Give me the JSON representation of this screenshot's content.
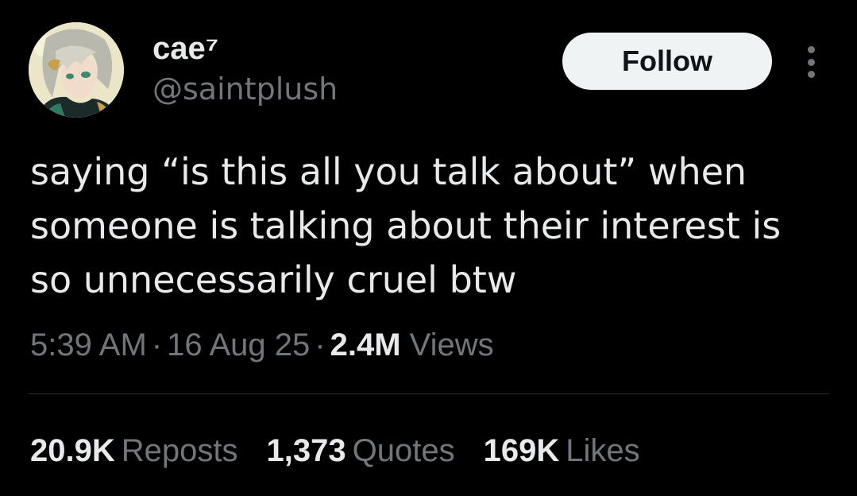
{
  "user": {
    "display_name": "cae⁷",
    "handle": "@saintplush",
    "avatar_icon": "anime-character-avatar"
  },
  "actions": {
    "follow_label": "Follow",
    "more_icon": "more-vertical-icon"
  },
  "tweet": {
    "lines": [
      "saying “is this all you talk about” when",
      "someone is talking about their interest is",
      "so unnecessarily cruel btw"
    ]
  },
  "meta": {
    "time": "5:39 AM",
    "date": "16 Aug 25",
    "views_count": "2.4M",
    "views_label": "Views"
  },
  "stats": [
    {
      "count": "20.9K",
      "label": "Reposts"
    },
    {
      "count": "1,373",
      "label": "Quotes"
    },
    {
      "count": "169K",
      "label": "Likes"
    }
  ],
  "colors": {
    "background": "#000000",
    "primary_text": "#e7e9ea",
    "secondary_text": "#71767b",
    "follow_button_bg": "#eff3f4",
    "divider": "#2f3336"
  }
}
